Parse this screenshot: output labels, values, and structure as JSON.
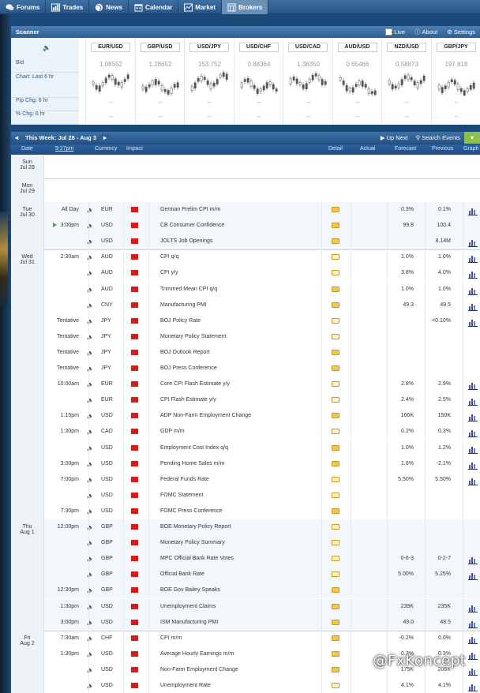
{
  "nav": [
    {
      "label": "Forums",
      "icon": "chat-icon"
    },
    {
      "label": "Trades",
      "icon": "chart-icon"
    },
    {
      "label": "News",
      "icon": "globe-icon"
    },
    {
      "label": "Calendar",
      "icon": "calendar-icon"
    },
    {
      "label": "Market",
      "icon": "market-icon"
    },
    {
      "label": "Brokers",
      "icon": "brokers-icon"
    }
  ],
  "scanner": {
    "title": "Scanner",
    "live": "Live",
    "about": "About",
    "settings": "Settings",
    "labels": [
      "Bid",
      "Chart: Last 6 hr",
      "Pip Chg: 6 hr",
      "% Chg: 6 hr"
    ],
    "pairs": [
      {
        "name": "EUR/USD",
        "bid": "1.08552",
        "pip": "--",
        "pct": "--"
      },
      {
        "name": "GBP/USD",
        "bid": "1.28652",
        "pip": "--",
        "pct": "--"
      },
      {
        "name": "USD/JPY",
        "bid": "153.752",
        "pip": "--",
        "pct": "--"
      },
      {
        "name": "USD/CHF",
        "bid": "0.88364",
        "pip": "--",
        "pct": "--"
      },
      {
        "name": "USD/CAD",
        "bid": "1.38350",
        "pip": "--",
        "pct": "--"
      },
      {
        "name": "AUD/USD",
        "bid": "0.65466",
        "pip": "--",
        "pct": "--"
      },
      {
        "name": "NZD/USD",
        "bid": "0.58873",
        "pip": "--",
        "pct": "--"
      },
      {
        "name": "GBP/JPY",
        "bid": "197.818",
        "pip": "--",
        "pct": "--"
      }
    ]
  },
  "week": {
    "label": "This Week: Jul 28 - Aug 3",
    "prev": "◄",
    "next": "►",
    "up_next": "Up Next",
    "search": "Search Events"
  },
  "columns": {
    "date": "Date",
    "time": "9:27pm",
    "currency": "Currency",
    "impact": "Impact",
    "detail": "Detail",
    "actual": "Actual",
    "forecast": "Forecast",
    "previous": "Previous",
    "graph": "Graph"
  },
  "days": [
    {
      "d1": "Sun",
      "d2": "Jul 28"
    },
    {
      "d1": "Mon",
      "d2": "Jul 29"
    },
    {
      "d1": "Tue",
      "d2": "Jul 30"
    },
    {
      "d1": "Wed",
      "d2": "Jul 31"
    },
    {
      "d1": "Thu",
      "d2": "Aug 1"
    },
    {
      "d1": "Fri",
      "d2": "Aug 2"
    }
  ],
  "events": [
    {
      "time": "All Day",
      "cur": "EUR",
      "event": "German Prelim CPI m/m",
      "forecast": "0.3%",
      "previous": "0.1%",
      "graph": true,
      "open": false
    },
    {
      "time": "3:00pm",
      "cur": "USD",
      "event": "CB Consumer Confidence",
      "forecast": "99.8",
      "previous": "100.4",
      "graph": false,
      "open": false,
      "next": true
    },
    {
      "time": "",
      "cur": "USD",
      "event": "JOLTS Job Openings",
      "forecast": "",
      "previous": "8.14M",
      "graph": true,
      "open": false
    },
    {
      "time": "2:30am",
      "cur": "AUD",
      "event": "CPI q/q",
      "forecast": "1.0%",
      "previous": "1.0%",
      "graph": true,
      "open": true
    },
    {
      "time": "",
      "cur": "AUD",
      "event": "CPI y/y",
      "forecast": "3.8%",
      "previous": "4.0%",
      "graph": true,
      "open": true
    },
    {
      "time": "",
      "cur": "AUD",
      "event": "Trimmed Mean CPI q/q",
      "forecast": "1.0%",
      "previous": "1.0%",
      "graph": true,
      "open": false
    },
    {
      "time": "",
      "cur": "CNY",
      "event": "Manufacturing PMI",
      "forecast": "49.3",
      "previous": "49.5",
      "graph": true,
      "open": false
    },
    {
      "time": "Tentative",
      "cur": "JPY",
      "event": "BOJ Policy Rate",
      "forecast": "",
      "previous": "<0.10%",
      "graph": true,
      "open": true
    },
    {
      "time": "Tentative",
      "cur": "JPY",
      "event": "Monetary Policy Statement",
      "forecast": "",
      "previous": "",
      "graph": false,
      "open": true
    },
    {
      "time": "Tentative",
      "cur": "JPY",
      "event": "BOJ Outlook Report",
      "forecast": "",
      "previous": "",
      "graph": false,
      "open": false
    },
    {
      "time": "Tentative",
      "cur": "JPY",
      "event": "BOJ Press Conference",
      "forecast": "",
      "previous": "",
      "graph": false,
      "open": false
    },
    {
      "time": "10:00am",
      "cur": "EUR",
      "event": "Core CPI Flash Estimate y/y",
      "forecast": "2.8%",
      "previous": "2.9%",
      "graph": true,
      "open": true
    },
    {
      "time": "",
      "cur": "EUR",
      "event": "CPI Flash Estimate y/y",
      "forecast": "2.4%",
      "previous": "2.5%",
      "graph": true,
      "open": true
    },
    {
      "time": "1:15pm",
      "cur": "USD",
      "event": "ADP Non-Farm Employment Change",
      "forecast": "166K",
      "previous": "150K",
      "graph": true,
      "open": false
    },
    {
      "time": "1:30pm",
      "cur": "CAD",
      "event": "GDP m/m",
      "forecast": "0.2%",
      "previous": "0.3%",
      "graph": true,
      "open": true
    },
    {
      "time": "",
      "cur": "USD",
      "event": "Employment Cost Index q/q",
      "forecast": "1.0%",
      "previous": "1.2%",
      "graph": true,
      "open": false
    },
    {
      "time": "3:00pm",
      "cur": "USD",
      "event": "Pending Home Sales m/m",
      "forecast": "1.6%",
      "previous": "-2.1%",
      "graph": true,
      "open": false
    },
    {
      "time": "7:00pm",
      "cur": "USD",
      "event": "Federal Funds Rate",
      "forecast": "5.50%",
      "previous": "5.50%",
      "graph": true,
      "open": true
    },
    {
      "time": "",
      "cur": "USD",
      "event": "FOMC Statement",
      "forecast": "",
      "previous": "",
      "graph": false,
      "open": true
    },
    {
      "time": "7:30pm",
      "cur": "USD",
      "event": "FOMC Press Conference",
      "forecast": "",
      "previous": "",
      "graph": false,
      "open": false
    },
    {
      "time": "12:00pm",
      "cur": "GBP",
      "event": "BOE Monetary Policy Report",
      "forecast": "",
      "previous": "",
      "graph": false,
      "open": true
    },
    {
      "time": "",
      "cur": "GBP",
      "event": "Monetary Policy Summary",
      "forecast": "",
      "previous": "",
      "graph": false,
      "open": true
    },
    {
      "time": "",
      "cur": "GBP",
      "event": "MPC Official Bank Rate Votes",
      "forecast": "0-6-3",
      "previous": "0-2-7",
      "graph": true,
      "open": true
    },
    {
      "time": "",
      "cur": "GBP",
      "event": "Official Bank Rate",
      "forecast": "5.00%",
      "previous": "5.25%",
      "graph": true,
      "open": true
    },
    {
      "time": "12:30pm",
      "cur": "GBP",
      "event": "BOE Gov Bailey Speaks",
      "forecast": "",
      "previous": "",
      "graph": false,
      "open": false
    },
    {
      "time": "1:30pm",
      "cur": "USD",
      "event": "Unemployment Claims",
      "forecast": "239K",
      "previous": "235K",
      "graph": true,
      "open": false
    },
    {
      "time": "3:00pm",
      "cur": "USD",
      "event": "ISM Manufacturing PMI",
      "forecast": "49.0",
      "previous": "48.5",
      "graph": true,
      "open": false
    },
    {
      "time": "7:30am",
      "cur": "CHF",
      "event": "CPI m/m",
      "forecast": "-0.2%",
      "previous": "0.0%",
      "graph": true,
      "open": false
    },
    {
      "time": "1:30pm",
      "cur": "USD",
      "event": "Average Hourly Earnings m/m",
      "forecast": "0.3%",
      "previous": "0.3%",
      "graph": true,
      "open": false
    },
    {
      "time": "",
      "cur": "USD",
      "event": "Non-Farm Employment Change",
      "forecast": "175K",
      "previous": "206K",
      "graph": true,
      "open": false
    },
    {
      "time": "",
      "cur": "USD",
      "event": "Unemployment Rate",
      "forecast": "4.1%",
      "previous": "4.1%",
      "graph": true,
      "open": true
    }
  ],
  "watermark": "@FxKoncept"
}
